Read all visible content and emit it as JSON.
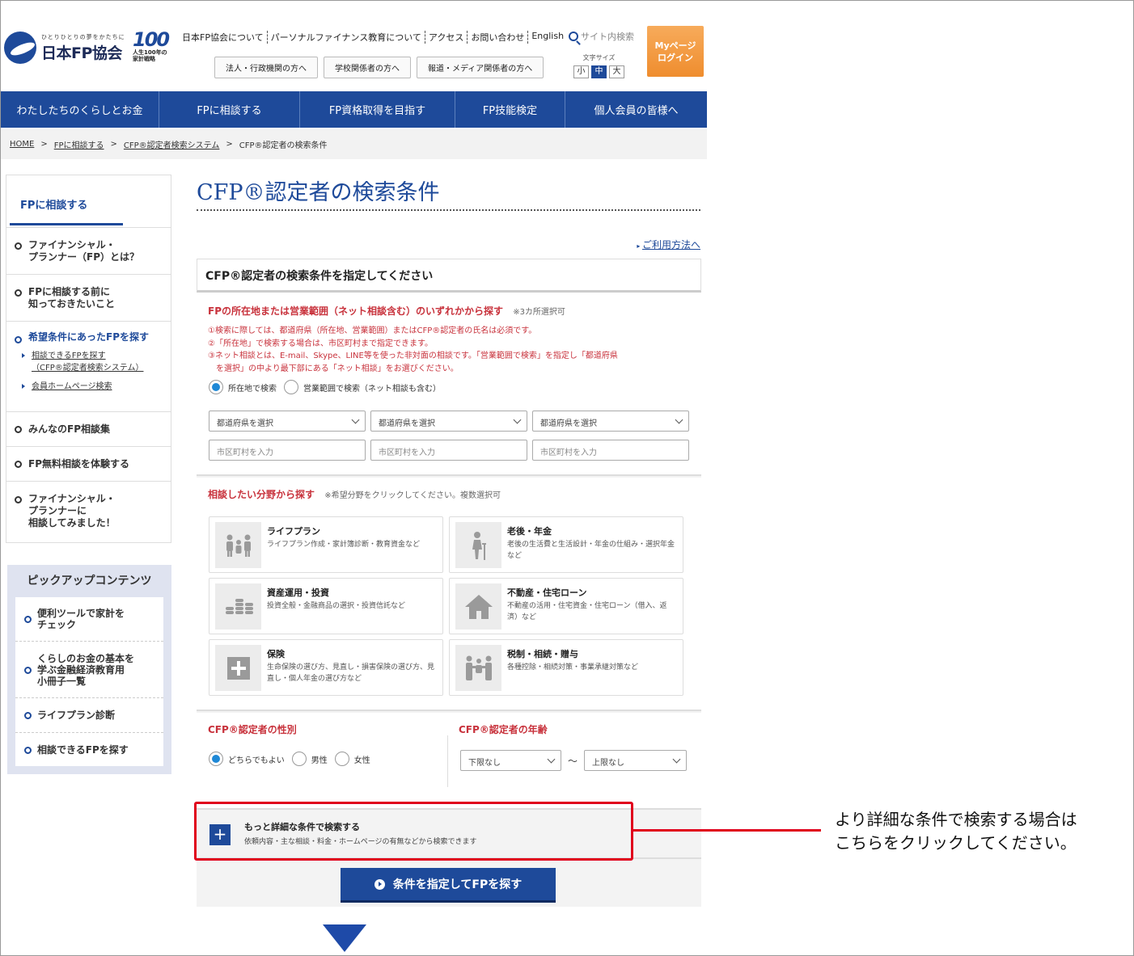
{
  "header": {
    "logo_tagline": "ひとりひとりの夢をかたちに",
    "logo_name": "日本FP協会",
    "badge_number": "100",
    "badge_sub1": "人生100年の",
    "badge_sub2": "家計戦略",
    "top_links": [
      "日本FP協会について",
      "パーソナルファイナンス教育について",
      "アクセス",
      "お問い合わせ",
      "English"
    ],
    "site_search_label": "サイト内検索",
    "audience_links": [
      "法人・行政機関の方へ",
      "学校関係者の方へ",
      "報道・メディア関係者の方へ"
    ],
    "font_size_label": "文字サイズ",
    "font_sizes": [
      "小",
      "中",
      "大"
    ],
    "mypage_line1": "Myページ",
    "mypage_line2": "ログイン"
  },
  "global_nav": [
    "わたしたちのくらしとお金",
    "FPに相談する",
    "FP資格取得を目指す",
    "FP技能検定",
    "個人会員の皆様へ"
  ],
  "breadcrumb": [
    "HOME",
    "FPに相談する",
    "CFP®認定者検索システム",
    "CFP®認定者の検索条件"
  ],
  "breadcrumb_sep": ">",
  "sidebar": {
    "title": "FPに相談する",
    "items": [
      {
        "label1": "ファイナンシャル・",
        "label2": "プランナー（FP）とは？"
      },
      {
        "label1": "FPに相談する前に",
        "label2": "知っておきたいこと"
      },
      {
        "label1": "希望条件にあったFPを探す"
      },
      {
        "label1": "みんなのFP相談集"
      },
      {
        "label1": "FP無料相談を体験する"
      },
      {
        "label1": "ファイナンシャル・",
        "label2": "プランナーに",
        "label3": "相談してみました！"
      }
    ],
    "sub_items": [
      {
        "line1": "相談できるFPを探す",
        "line2": "（CFP®認定者検索システム）"
      },
      {
        "line1": "会員ホームページ検索"
      }
    ]
  },
  "pickup": {
    "title": "ピックアップコンテンツ",
    "items": [
      {
        "line1": "便利ツールで家計を",
        "line2": "チェック"
      },
      {
        "line1": "くらしのお金の基本を",
        "line2": "学ぶ金融経済教育用",
        "line3": "小冊子一覧"
      },
      {
        "line1": "ライフプラン診断"
      },
      {
        "line1": "相談できるFPを探す"
      }
    ]
  },
  "main": {
    "page_title": "CFP®認定者の検索条件",
    "usage_link": "ご利用方法へ",
    "panel_title": "CFP®認定者の検索条件を指定してください",
    "area_heading": "FPの所在地または営業範囲（ネット相談含む）のいずれかから探す",
    "area_note": "※3カ所選択可",
    "notes": [
      "①検索に際しては、都道府県（所在地、営業範囲）またはCFP®認定者の氏名は必須です。",
      "②「所在地」で検索する場合は、市区町村まで指定できます。",
      "③ネット相談とは、E-mail、Skype、LINE等を使った非対面の相談です。「営業範囲で検索」を指定し「都道府県",
      "　を選択」の中より最下部にある「ネット相談」をお選びください。"
    ],
    "radio_location": "所在地で検索",
    "radio_range": "営業範囲で検索（ネット相談も含む）",
    "pref_placeholder": "都道府県を選択",
    "city_placeholder": "市区町村を入力",
    "field_heading": "相談したい分野から探す",
    "field_note": "※希望分野をクリックしてください。複数選択可",
    "fields": [
      {
        "title": "ライフプラン",
        "desc": "ライフプラン作成・家計簿診断・教育資金など",
        "icon": "family-icon"
      },
      {
        "title": "老後・年金",
        "desc": "老後の生活費と生活設計・年金の仕組み・選択年金など",
        "icon": "elderly-icon"
      },
      {
        "title": "資産運用・投資",
        "desc": "投資全般・金融商品の選択・投資信託など",
        "icon": "coins-icon"
      },
      {
        "title": "不動産・住宅ローン",
        "desc": "不動産の活用・住宅資金・住宅ローン（借入、返済）など",
        "icon": "house-icon"
      },
      {
        "title": "保険",
        "desc": "生命保険の選び方、見直し・損害保険の選び方、見直し・個人年金の選び方など",
        "icon": "plus-cross-icon"
      },
      {
        "title": "税制・相続・贈与",
        "desc": "各種控除・相続対策・事業承継対策など",
        "icon": "people-icon"
      }
    ],
    "gender_heading": "CFP®認定者の性別",
    "gender_options": [
      "どちらでもよい",
      "男性",
      "女性"
    ],
    "age_heading": "CFP®認定者の年齢",
    "age_min": "下限なし",
    "age_sep": "〜",
    "age_max": "上限なし",
    "detail_title": "もっと詳細な条件で検索する",
    "detail_desc": "依頼内容・主な相談・料金・ホームページの有無などから検索できます",
    "submit_label": "条件を指定してFPを探す"
  },
  "annotation": {
    "line1": "より詳細な条件で検索する場合は",
    "line2": "こちらをクリックしてください。",
    "color": "#e0001c"
  },
  "colors": {
    "brand": "#1e4a9a",
    "accent_orange": "#ef8d2e",
    "heading_red": "#c8323c"
  }
}
